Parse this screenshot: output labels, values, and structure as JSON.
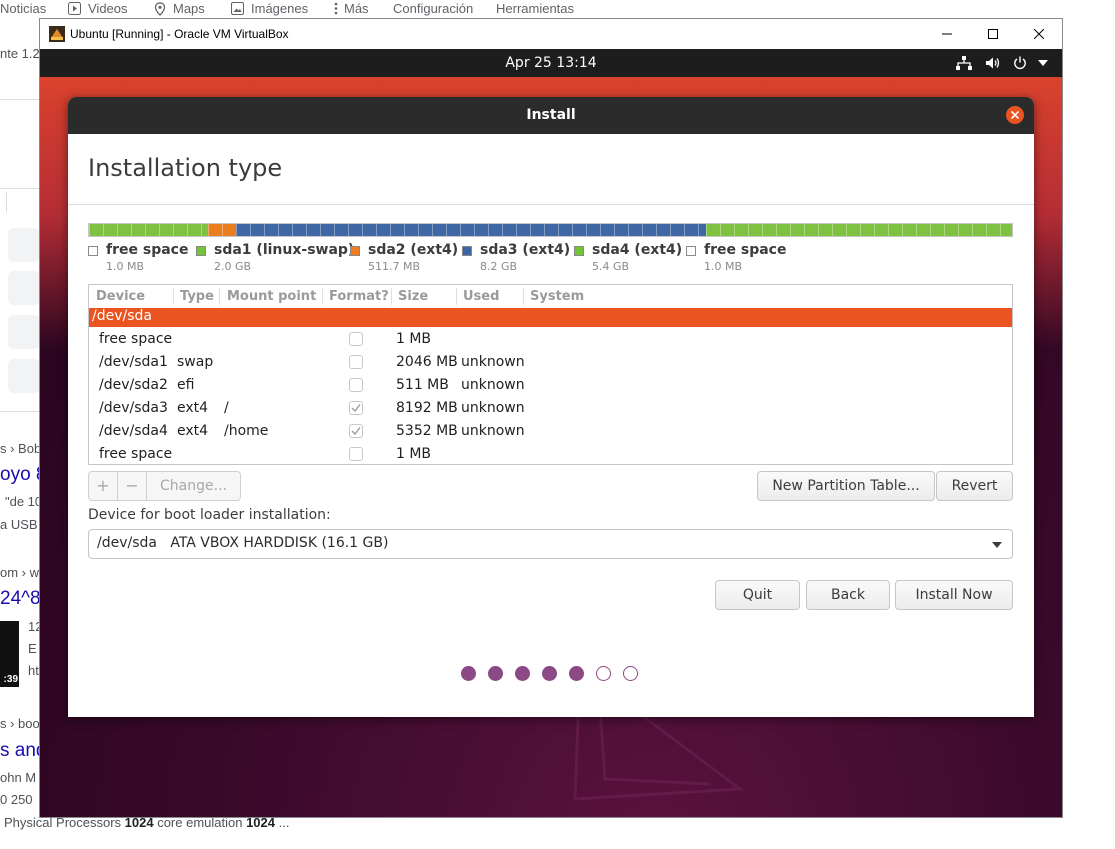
{
  "browser": {
    "nav": [
      {
        "label": "Noticias",
        "icon": ""
      },
      {
        "label": "Videos",
        "icon": "play-icon"
      },
      {
        "label": "Maps",
        "icon": "map-pin-icon"
      },
      {
        "label": "Imágenes",
        "icon": "image-icon"
      },
      {
        "label": "Más",
        "icon": "more-vertical-icon"
      },
      {
        "label": "Configuración",
        "icon": ""
      },
      {
        "label": "Herramientas",
        "icon": ""
      }
    ],
    "fragments": {
      "f1": "nte 1.2",
      "f2": "s › Bob",
      "f3": "oyo 8",
      "f4": "\"de 10",
      "f5": "a USB",
      "f6": "om › w",
      "f7": "24^8",
      "f8": "12",
      "f9": "E",
      "f10": "ht",
      "thumb_time": ":39",
      "f11": "s › boo",
      "f12": "s and",
      "f13": "ohn M",
      "f14": "0 250",
      "bottom_pre": "Physical Processors ",
      "bottom_b1": "1024",
      "bottom_mid": " core emulation ",
      "bottom_b2": "1024",
      "bottom_post": " ..."
    }
  },
  "vbox": {
    "title": "Ubuntu [Running] - Oracle VM VirtualBox",
    "controls": [
      "minimize-icon",
      "maximize-icon",
      "close-icon"
    ]
  },
  "ubuntu": {
    "clock": "Apr 25  13:14",
    "tray_icons": [
      "network-icon",
      "volume-icon",
      "power-icon",
      "dropdown-icon"
    ]
  },
  "dialog": {
    "title": "Install",
    "page_title": "Installation type",
    "partition_bar": [
      {
        "name": "free space",
        "color": "#7fc241",
        "fraction": 0.129
      },
      {
        "name": "sda2",
        "color": "#e97e21",
        "fraction": 0.03
      },
      {
        "name": "sda3",
        "color": "#3f67a5",
        "fraction": 0.51
      },
      {
        "name": "sda4",
        "color": "#7fc241",
        "fraction": 0.331
      }
    ],
    "legend": [
      {
        "name": "free space",
        "size": "1.0 MB",
        "color": "#ffffff"
      },
      {
        "name": "sda1 (linux-swap)",
        "size": "2.0 GB",
        "color": "#73c43a"
      },
      {
        "name": "sda2 (ext4)",
        "size": "511.7 MB",
        "color": "#ef7d22"
      },
      {
        "name": "sda3 (ext4)",
        "size": "8.2 GB",
        "color": "#3e64a4"
      },
      {
        "name": "sda4 (ext4)",
        "size": "5.4 GB",
        "color": "#73c43a"
      },
      {
        "name": "free space",
        "size": "1.0 MB",
        "color": "#ffffff"
      }
    ],
    "table": {
      "columns": [
        "Device",
        "Type",
        "Mount point",
        "Format?",
        "Size",
        "Used",
        "System"
      ],
      "selected_device": "/dev/sda",
      "rows": [
        {
          "device": "free space",
          "type": "",
          "mount": "",
          "format": false,
          "size": "1 MB",
          "used": ""
        },
        {
          "device": "/dev/sda1",
          "type": "swap",
          "mount": "",
          "format": false,
          "size": "2046 MB",
          "used": "unknown"
        },
        {
          "device": "/dev/sda2",
          "type": "efi",
          "mount": "",
          "format": false,
          "size": "511 MB",
          "used": "unknown"
        },
        {
          "device": "/dev/sda3",
          "type": "ext4",
          "mount": "/",
          "format": true,
          "size": "8192 MB",
          "used": "unknown"
        },
        {
          "device": "/dev/sda4",
          "type": "ext4",
          "mount": "/home",
          "format": true,
          "size": "5352 MB",
          "used": "unknown"
        },
        {
          "device": "free space",
          "type": "",
          "mount": "",
          "format": false,
          "size": "1 MB",
          "used": ""
        }
      ]
    },
    "buttons": {
      "add": "+",
      "remove": "−",
      "change": "Change...",
      "new_table": "New Partition Table...",
      "revert": "Revert",
      "quit": "Quit",
      "back": "Back",
      "install": "Install Now"
    },
    "boot_label": "Device for boot loader installation:",
    "boot_device": "/dev/sda   ATA VBOX HARDDISK (16.1 GB)",
    "steps": {
      "total": 7,
      "completed": 5
    },
    "accent": "#e95420",
    "step_color": "#8b4a86"
  }
}
